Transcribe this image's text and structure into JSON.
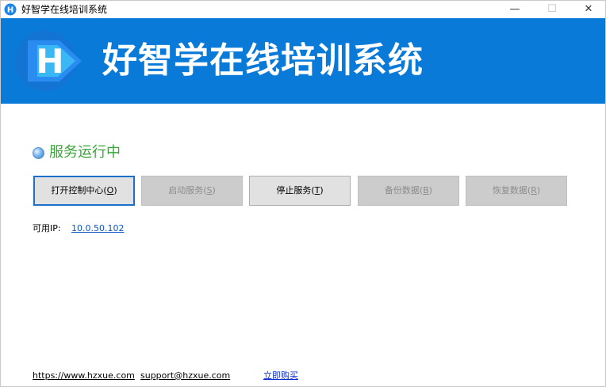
{
  "window": {
    "title": "好智学在线培训系统",
    "minimize_glyph": "—",
    "maximize_glyph": "☐",
    "close_glyph": "✕"
  },
  "banner": {
    "title": "好智学在线培训系统",
    "logo_letter": "H"
  },
  "status": {
    "text": "服务运行中"
  },
  "buttons": [
    {
      "label": "打开控制中心(",
      "hotkey": "O",
      "suffix": ")",
      "state": "focused"
    },
    {
      "label": "启动服务(",
      "hotkey": "S",
      "suffix": ")",
      "state": "disabled"
    },
    {
      "label": "停止服务(",
      "hotkey": "T",
      "suffix": ")",
      "state": "enabled"
    },
    {
      "label": "备份数据(",
      "hotkey": "B",
      "suffix": ")",
      "state": "disabled"
    },
    {
      "label": "恢复数据(",
      "hotkey": "R",
      "suffix": ")",
      "state": "disabled"
    }
  ],
  "ip": {
    "label": "可用IP:",
    "value": "10.0.50.102"
  },
  "footer": {
    "website": "https://www.hzxue.com",
    "email": "support@hzxue.com",
    "buy": "立即购买"
  },
  "colors": {
    "banner_bg": "#0a7ad8",
    "status_green": "#3aa33a",
    "link_blue": "#0d55c6"
  }
}
